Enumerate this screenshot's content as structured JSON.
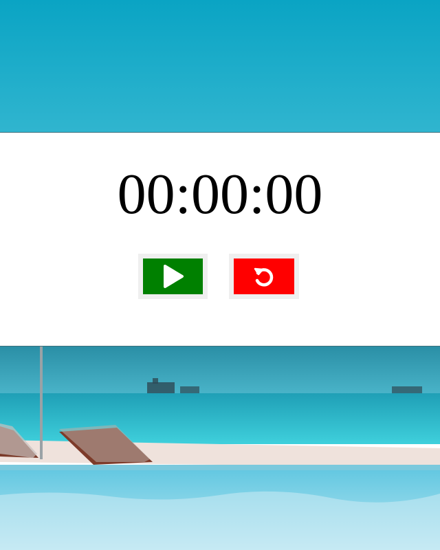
{
  "timer": {
    "display": "00:00:00"
  },
  "controls": {
    "start": {
      "icon": "play-icon",
      "color": "#008000"
    },
    "reset": {
      "icon": "reset-icon",
      "color": "#ff0000"
    }
  },
  "background": {
    "description_colors": {
      "sky": "#12a9c8",
      "sea": "#2cc4d8",
      "sand": "#f1e4df",
      "pool": "#8fd6ea"
    }
  }
}
